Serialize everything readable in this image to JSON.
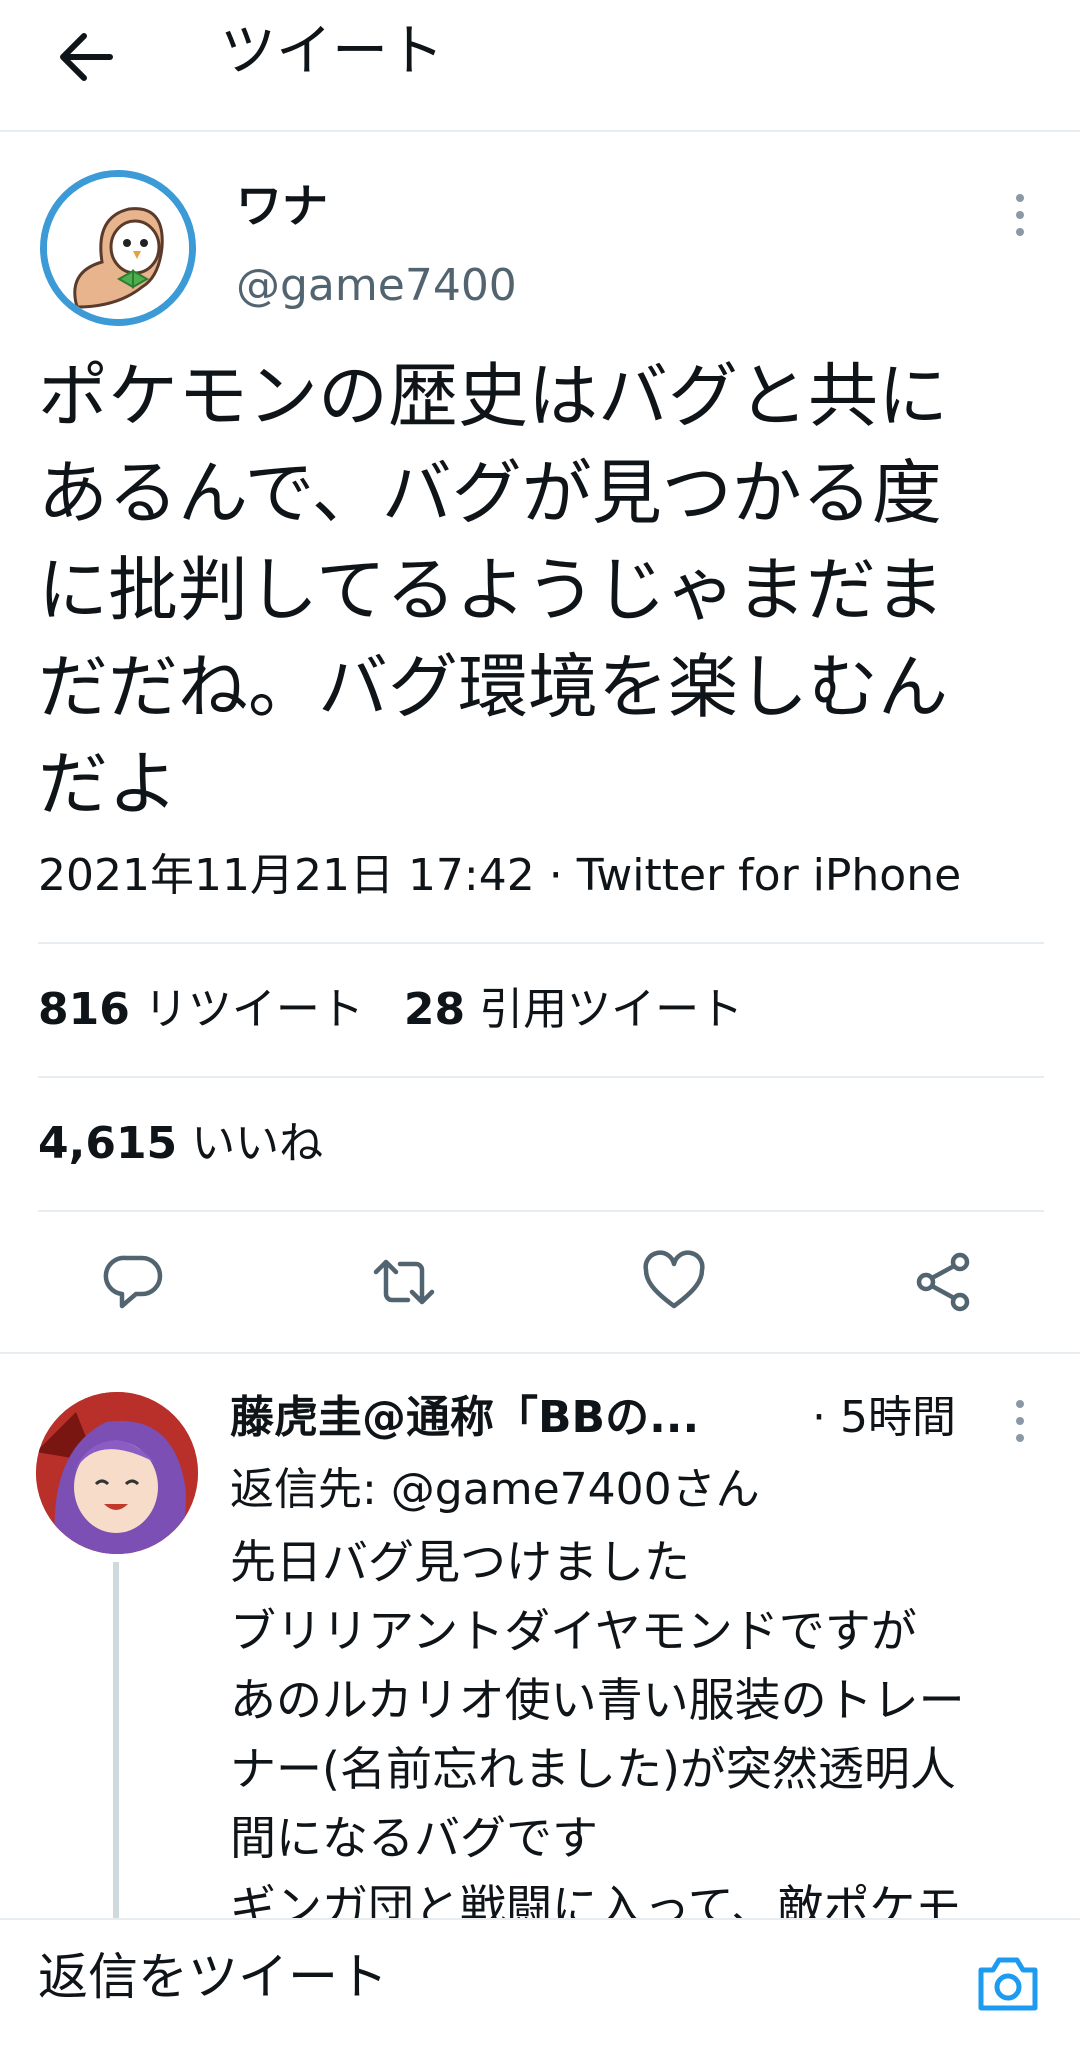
{
  "header": {
    "title": "ツイート",
    "back_icon": "arrow-left-icon"
  },
  "tweet": {
    "author_name": "ワナ",
    "author_handle": "@game7400",
    "text_lines": [
      "ポケモンの歴史はバグと共に",
      "あるんで、バグが見つかる度",
      "に批判してるようじゃまだま",
      "だだね。バグ環境を楽しむん",
      "だよ"
    ],
    "meta": "2021年11月21日 17:42 · Twitter for iPhone",
    "stats": {
      "retweets_count": "816",
      "retweets_label": "リツイート",
      "quotes_count": "28",
      "quotes_label": "引用ツイート",
      "likes_count": "4,615",
      "likes_label": "いいね"
    },
    "actions": [
      "reply-icon",
      "retweet-icon",
      "like-icon",
      "share-icon"
    ]
  },
  "reply": {
    "author_name": "藤虎圭@通称「BBの...",
    "time": "· 5時間",
    "reply_to": "返信先: @game7400さん",
    "body_lines": [
      "先日バグ見つけました",
      "ブリリアントダイヤモンドですが",
      "あのルカリオ使い青い服装のトレー",
      "ナー(名前忘れました)が突然透明人",
      "間になるバグです",
      "ギンガ団と戦闘に入って、敵ポケモ"
    ]
  },
  "composer": {
    "placeholder": "返信をツイート",
    "camera_icon": "camera-icon"
  },
  "colors": {
    "accent": "#1d9bf0",
    "text": "#0f1419",
    "secondary": "#536471",
    "divider": "#e6ecf0",
    "avatar_ring": "#3c9ad6"
  }
}
